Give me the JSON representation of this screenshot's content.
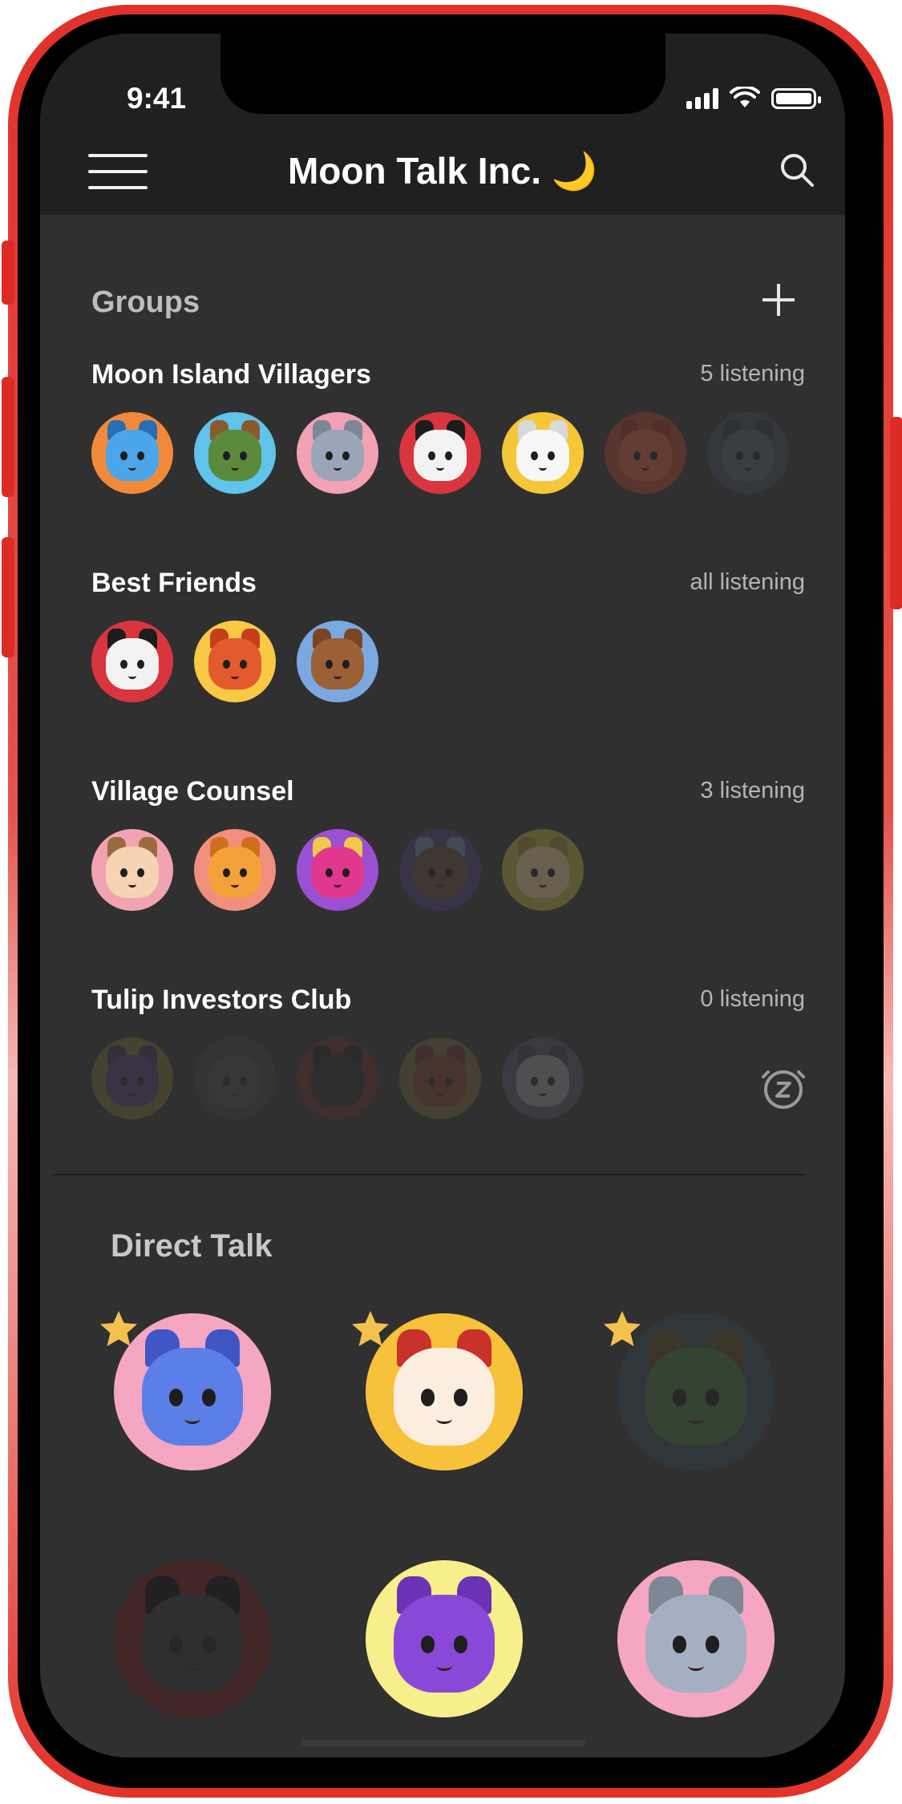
{
  "status_bar": {
    "time": "9:41"
  },
  "header": {
    "title": "Moon Talk Inc.",
    "title_emoji": "🌙"
  },
  "groups_section": {
    "title": "Groups"
  },
  "groups": [
    {
      "name": "Moon Island Villagers",
      "count": "5 listening",
      "members": [
        {
          "bg": "#f08a3a",
          "face": "#4aa6e8",
          "ear": "#2a6db2"
        },
        {
          "bg": "#5fc3ea",
          "face": "#5b8a3c",
          "ear": "#8a5a2e"
        },
        {
          "bg": "#f3a1b4",
          "face": "#9aa6b7",
          "ear": "#7d8796"
        },
        {
          "bg": "#d9353e",
          "face": "#f2f2f2",
          "ear": "#1d1d1d"
        },
        {
          "bg": "#f5c637",
          "face": "#f7f7f7",
          "ear": "#d9d9d9"
        },
        {
          "bg": "#a23f2a",
          "face": "#c2533a",
          "ear": "#8f2f1c",
          "faded": true
        },
        {
          "bg": "#3c4452",
          "face": "#4d5868",
          "ear": "#2f3540",
          "faded": true
        }
      ]
    },
    {
      "name": "Best Friends",
      "count": "all listening",
      "members": [
        {
          "bg": "#d9353e",
          "face": "#f2f2f2",
          "ear": "#1d1d1d"
        },
        {
          "bg": "#f7c944",
          "face": "#e35a2c",
          "ear": "#c63f1b"
        },
        {
          "bg": "#7aa8e0",
          "face": "#9c6036",
          "ear": "#7b4423"
        }
      ]
    },
    {
      "name": "Village Counsel",
      "count": "3 listening",
      "members": [
        {
          "bg": "#f1a3b1",
          "face": "#f6d4b3",
          "ear": "#9a6b3f"
        },
        {
          "bg": "#f28e7d",
          "face": "#f5a13a",
          "ear": "#cf6f1d"
        },
        {
          "bg": "#9b4fd1",
          "face": "#e0388f",
          "ear": "#f0c84a"
        },
        {
          "bg": "#4a3a73",
          "face": "#5e4434",
          "ear": "#6b7a9a",
          "faded": true
        },
        {
          "bg": "#a7a336",
          "face": "#d2b88a",
          "ear": "#8e7a34",
          "faded": true
        }
      ]
    },
    {
      "name": "Tulip Investors Club",
      "count": "0 listening",
      "members": [
        {
          "bg": "#a99332",
          "face": "#6a3ca6",
          "ear": "#4a2a78",
          "faded": true
        },
        {
          "bg": "#4a4a4a",
          "face": "#5a5a5a",
          "ear": "#444444",
          "faded": true
        },
        {
          "bg": "#8a2a2a",
          "face": "#222222",
          "ear": "#111111",
          "faded": true
        },
        {
          "bg": "#a38a3a",
          "face": "#b4462e",
          "ear": "#8a3020",
          "faded": true
        },
        {
          "bg": "#6a7090",
          "face": "#d8dae8",
          "ear": "#444860",
          "faded": true
        }
      ]
    }
  ],
  "direct_talk": {
    "title": "Direct Talk",
    "contacts": [
      {
        "bg": "#f4a6c2",
        "face": "#5b7fe6",
        "ear": "#3f56c4",
        "starred": true
      },
      {
        "bg": "#f7c13a",
        "face": "#fbeede",
        "ear": "#c8322b",
        "starred": true
      },
      {
        "bg": "#2e4048",
        "face": "#3a5a36",
        "ear": "#4a3a22",
        "starred": true,
        "faded": true
      },
      {
        "bg": "#5a1a1a",
        "face": "#2e2e2e",
        "ear": "#111111",
        "starred": false,
        "faded": true
      },
      {
        "bg": "#f7ee8c",
        "face": "#8a48d8",
        "ear": "#6a32b4",
        "starred": false
      },
      {
        "bg": "#f4a6c2",
        "face": "#a4afc2",
        "ear": "#7d8796",
        "starred": false
      }
    ]
  },
  "colors": {
    "accent": "#e1312a",
    "star": "#f2c14e",
    "bg": "#303030",
    "header_bg": "#202020"
  }
}
